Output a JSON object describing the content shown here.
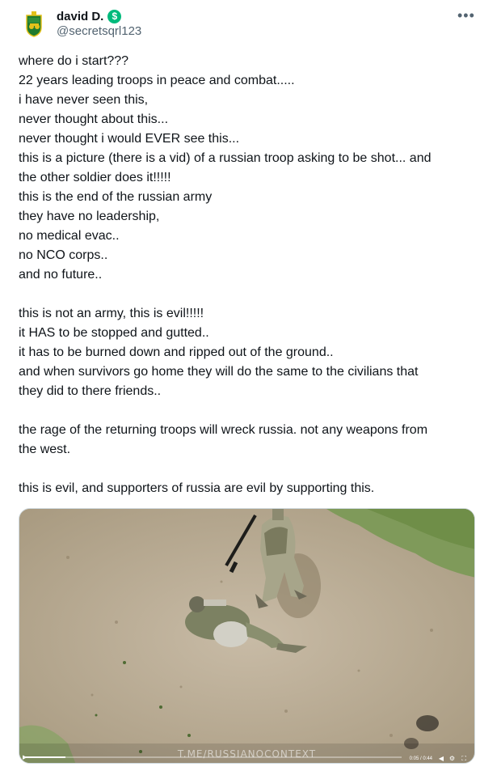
{
  "author": {
    "display_name": "david D.",
    "handle": "@secretsqrl123",
    "verified_badge_icon": "$",
    "verified_color": "#00ba7c"
  },
  "more_icon": "•••",
  "tweet_lines": [
    "where do i start???",
    "22 years leading troops in peace and combat.....",
    "i have never seen this,",
    "never thought about this...",
    "never thought i would EVER see this...",
    "this is a picture (there is a vid) of a russian troop asking to be shot... and",
    "the other soldier does it!!!!!",
    "this is the end of the russian army",
    "they have no leadership,",
    "no medical evac..",
    "no NCO corps..",
    "and no future..",
    "",
    "this is not an army, this is evil!!!!!",
    "it HAS to be stopped and gutted..",
    "it has to be burned down and ripped out of the ground..",
    "and when survivors go home they will do the same to the civilians that",
    "they did to there friends..",
    "",
    "the rage of the returning troops will wreck russia. not any weapons from",
    "the west.",
    "",
    "this is evil, and supporters of russia are evil by supporting this."
  ],
  "media": {
    "watermark": "T.ME/RUSSIANOCONTEXT",
    "time": "0:05 / 0:44",
    "progress": 0.11,
    "icons": [
      "play-icon",
      "volume-icon",
      "settings-icon",
      "fullscreen-icon"
    ]
  }
}
